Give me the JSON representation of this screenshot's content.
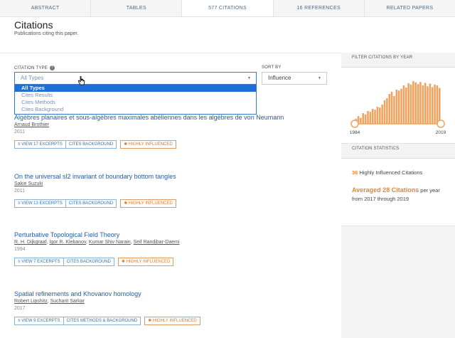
{
  "tabs": [
    {
      "label": "ABSTRACT"
    },
    {
      "label": "TABLES"
    },
    {
      "label": "577 CITATIONS"
    },
    {
      "label": "16 REFERENCES"
    },
    {
      "label": "RELATED PAPERS"
    }
  ],
  "section": {
    "title": "Citations",
    "subtitle": "Publications citing this paper."
  },
  "filters": {
    "citation_type_label": "CITATION TYPE",
    "citation_type_value": "All Types",
    "citation_type_options": [
      "All Types",
      "Cites Results",
      "Cites Methods",
      "Cites Background"
    ],
    "sort_label": "SORT BY",
    "sort_value": "Influence"
  },
  "papers": [
    {
      "title": "Algèbres planaires et sous-algèbres maximales abéliennes dans les algèbres de von Neumann",
      "authors": [
        "Arnaud Brothier"
      ],
      "year": "2011",
      "excerpts": "VIEW 17 EXCERPTS",
      "cites": "CITES BACKGROUND",
      "influence": "HIGHLY INFLUENCED"
    },
    {
      "title": "On the universal sl2 invariant of boundary bottom tangles",
      "authors": [
        "Sakie Suzuki"
      ],
      "year": "2011",
      "excerpts": "VIEW 13 EXCERPTS",
      "cites": "CITES BACKGROUND",
      "influence": "HIGHLY INFLUENCED"
    },
    {
      "title": "Perturbative Topological Field Theory",
      "authors": [
        "R. H. Dijkgraaf",
        "Igor R. Klebanov",
        "Kumar Shiv Narain",
        "Seif Randjbar-Daemi"
      ],
      "year": "1994",
      "excerpts": "VIEW 7 EXCERPTS",
      "cites": "CITES BACKGROUND",
      "influence": "HIGHLY INFLUENCED"
    },
    {
      "title": "Spatial refinements and Khovanov homology",
      "authors": [
        "Robert Lipshitz",
        "Sucharit Sarkar"
      ],
      "year": "2017",
      "excerpts": "VIEW 9 EXCERPTS",
      "cites": "CITES METHODS & BACKGROUND",
      "influence": "HIGHLY INFLUENCED"
    }
  ],
  "sidebar": {
    "filter_title": "FILTER CITATIONS BY YEAR",
    "year_start": "1984",
    "year_end": "2019",
    "histogram_fraction_heights": [
      0.12,
      0.18,
      0.14,
      0.25,
      0.22,
      0.3,
      0.28,
      0.35,
      0.33,
      0.4,
      0.38,
      0.45,
      0.55,
      0.6,
      0.7,
      0.75,
      0.65,
      0.8,
      0.78,
      0.82,
      0.9,
      0.85,
      0.95,
      0.92,
      1.0,
      0.97,
      0.93,
      0.98,
      0.9,
      0.96,
      0.88,
      0.94,
      0.86,
      0.92,
      0.9,
      0.84
    ],
    "stats_title": "CITATION STATISTICS",
    "highly_influenced_count": "36",
    "highly_influenced_text": "Highly Influenced Citations",
    "averaged_text": "Averaged 28 Citations",
    "per_year_text": "per year",
    "range_text": "from 2017 through 2019"
  },
  "colors": {
    "accent": "#e0873a",
    "link": "#1f5fa6",
    "selected": "#1f6fd8",
    "bar": "#f0a35e"
  }
}
